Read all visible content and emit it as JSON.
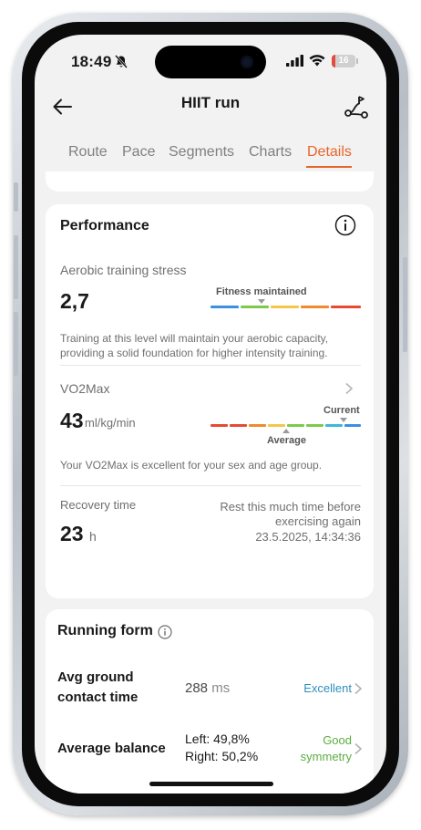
{
  "status_bar": {
    "time": "18:49",
    "battery": "16",
    "battery_level": 0.16,
    "icons": [
      "bell-slash-icon",
      "signal-icon",
      "wifi-icon",
      "battery-icon"
    ]
  },
  "header": {
    "title": "HIIT run",
    "back_icon": "arrow-left-icon",
    "route_icon": "route-icon"
  },
  "tabs": {
    "items": [
      "Route",
      "Pace",
      "Segments",
      "Charts",
      "Details"
    ],
    "active": "Details",
    "active_color": "#e8652a"
  },
  "performance": {
    "title": "Performance",
    "info_icon": "info-icon",
    "aerobic": {
      "label": "Aerobic training stress",
      "value": "2,7",
      "scale_label": "Fitness maintained",
      "scale_colors": [
        "#3d8fe0",
        "#7dc94b",
        "#f4c64a",
        "#f08a2e",
        "#e64a32"
      ],
      "description": "Training at this level will maintain your aerobic capacity, providing a solid foundation for higher intensity training."
    },
    "vo2max": {
      "label": "VO2Max",
      "value": "43",
      "unit": "ml/kg/min",
      "current_label": "Current",
      "average_label": "Average",
      "scale_colors": [
        "#e64a32",
        "#e64a32",
        "#f08a2e",
        "#f4c64a",
        "#7dc94b",
        "#7dc94b",
        "#3db8d9",
        "#3d8fe0"
      ],
      "description": "Your VO2Max is excellent for your sex and age group."
    },
    "recovery": {
      "label": "Recovery time",
      "value": "23",
      "unit": "h",
      "note_line1": "Rest this much time before",
      "note_line2": "exercising again",
      "until": "23.5.2025, 14:34:36"
    }
  },
  "running_form": {
    "title": "Running form",
    "info_icon": "info-icon",
    "ground_contact": {
      "label_line1": "Avg ground",
      "label_line2": "contact time",
      "value": "288",
      "unit": "ms",
      "status": "Excellent",
      "status_color": "#2d8fbd"
    },
    "balance": {
      "label": "Average balance",
      "left": "Left: 49,8%",
      "right": "Right: 50,2%",
      "status_line1": "Good",
      "status_line2": "symmetry",
      "status_color": "#5aad3f"
    }
  }
}
